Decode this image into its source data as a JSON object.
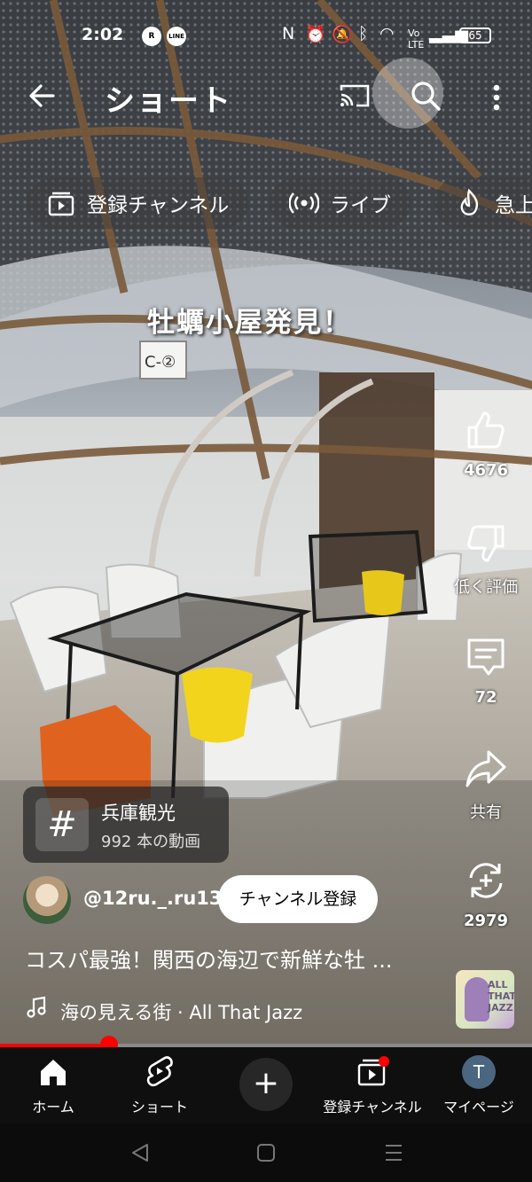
{
  "status_bar": {
    "time": "2:02",
    "battery": "65",
    "app_badges": [
      "R",
      "LINE"
    ]
  },
  "header": {
    "title": "ショート",
    "back_icon": "arrow-left-icon",
    "cast_icon": "cast-icon",
    "search_icon": "search-icon",
    "more_icon": "more-vertical-icon"
  },
  "chips": [
    {
      "label": "登録チャンネル",
      "icon": "subscriptions-icon"
    },
    {
      "label": "ライブ",
      "icon": "live-icon"
    },
    {
      "label": "急上",
      "icon": "trending-icon"
    }
  ],
  "video": {
    "caption": "牡蠣小屋発見！"
  },
  "actions": {
    "like_count": "4676",
    "dislike_label": "低く評価",
    "comment_count": "72",
    "share_label": "共有",
    "remix_count": "2979"
  },
  "hashtag_card": {
    "symbol": "#",
    "title": "兵庫観光",
    "subtitle": "992 本の動画"
  },
  "channel": {
    "handle": "@12ru._.ru13",
    "subscribe_label": "チャンネル登録"
  },
  "description": "コスパ最強！関西の海辺で新鮮な牡 ...",
  "music": {
    "text": "海の見える街 · All That Jazz",
    "thumb_text": "ALL\nTHAT\nJAZZ"
  },
  "progress": {
    "fraction": 0.205,
    "color": "#ff0000"
  },
  "bottom_nav": [
    {
      "label": "ホーム",
      "icon": "home-icon"
    },
    {
      "label": "ショート",
      "icon": "shorts-icon"
    },
    {
      "label": "",
      "icon": "plus-icon"
    },
    {
      "label": "登録チャンネル",
      "icon": "subscriptions-icon"
    },
    {
      "label": "マイページ",
      "icon": "avatar",
      "initial": "T"
    }
  ],
  "system_nav": [
    "back-icon",
    "home-icon",
    "recents-icon"
  ]
}
